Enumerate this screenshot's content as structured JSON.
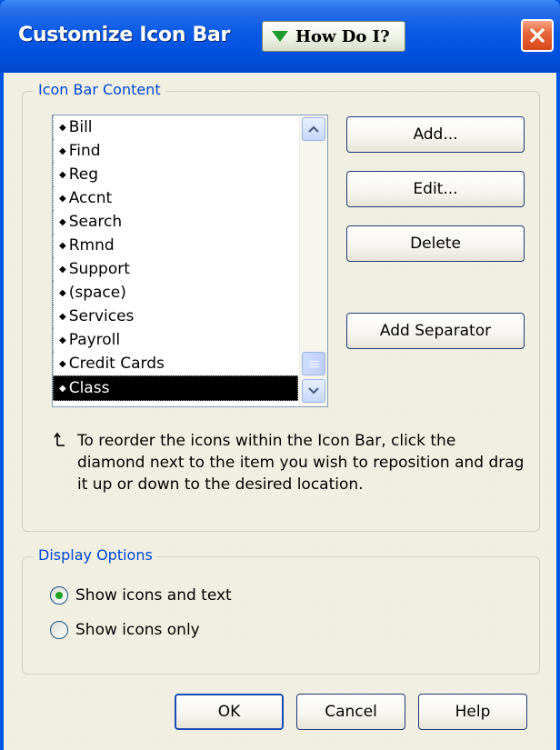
{
  "window": {
    "title": "Customize Icon Bar",
    "help_button_label": "How Do I?"
  },
  "content_group": {
    "title": "Icon Bar Content",
    "items": [
      {
        "label": "Bill"
      },
      {
        "label": "Find"
      },
      {
        "label": "Reg"
      },
      {
        "label": "Accnt"
      },
      {
        "label": "Search"
      },
      {
        "label": "Rmnd"
      },
      {
        "label": "Support"
      },
      {
        "label": "(space)"
      },
      {
        "label": "Services"
      },
      {
        "label": "Payroll"
      },
      {
        "label": "Credit Cards"
      },
      {
        "label": "Class",
        "selected": true
      }
    ],
    "buttons": {
      "add": "Add...",
      "edit": "Edit...",
      "delete": "Delete",
      "add_separator": "Add Separator"
    },
    "hint": "To reorder the icons within the Icon Bar, click the diamond next to the item you wish to reposition and drag it up or down to the desired location."
  },
  "display_options": {
    "title": "Display Options",
    "options": [
      {
        "label": "Show icons and text",
        "checked": true
      },
      {
        "label": "Show icons only",
        "checked": false
      }
    ]
  },
  "footer": {
    "ok": "OK",
    "cancel": "Cancel",
    "help": "Help"
  },
  "colors": {
    "title_bar": "#0054e3",
    "dialog_bg": "#f1efe2",
    "group_title": "#0046d5",
    "selected_item_bg": "#000000",
    "close_button": "#e8683c",
    "radio_checked": "#21a121"
  },
  "icons": [
    "close-icon",
    "green-down-triangle-icon",
    "reorder-arrow-icon",
    "scroll-up-icon",
    "scroll-down-icon",
    "diamond-icon"
  ]
}
